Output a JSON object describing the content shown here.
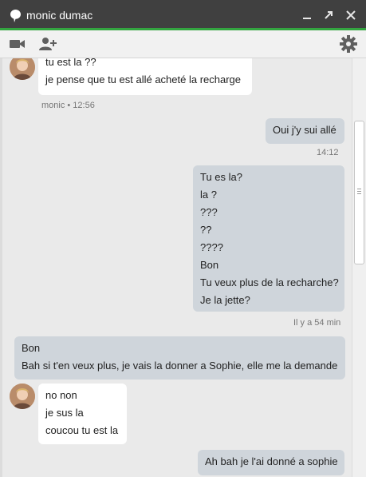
{
  "window": {
    "title": "monic dumac",
    "minimize_icon": "minimize-icon",
    "popout_icon": "popout-icon",
    "close_icon": "close-icon"
  },
  "toolbar": {
    "video_icon": "video-camera-icon",
    "add_user_icon": "add-user-icon",
    "settings_icon": "gear-icon"
  },
  "colors": {
    "title_bar": "#404040",
    "accent": "#33a540",
    "incoming_bubble": "#ffffff",
    "outgoing_bubble": "#cfd5db"
  },
  "messages": [
    {
      "from": "contact",
      "lines": [
        "tu est la ??",
        "je pense que tu est allé acheté la recharge"
      ],
      "meta": "monic • 12:56"
    },
    {
      "from": "me",
      "lines": [
        "Oui j'y sui allé"
      ],
      "meta": "14:12"
    },
    {
      "from": "me",
      "lines": [
        "Tu es la?",
        "la ?",
        "???",
        "??",
        "????",
        "Bon",
        "Tu veux plus de la recharche?",
        "Je la jette?"
      ],
      "meta": "Il y a 54 min"
    },
    {
      "from": "contact",
      "lines": [
        "Bon",
        "Bah si t'en veux plus, je vais la donner a Sophie, elle me la demande"
      ]
    },
    {
      "from": "contact",
      "lines": [
        "no non",
        "je sus la",
        "coucou tu est la"
      ]
    },
    {
      "from": "me",
      "lines": [
        "Ah bah je l'ai donné a sophie"
      ]
    }
  ]
}
